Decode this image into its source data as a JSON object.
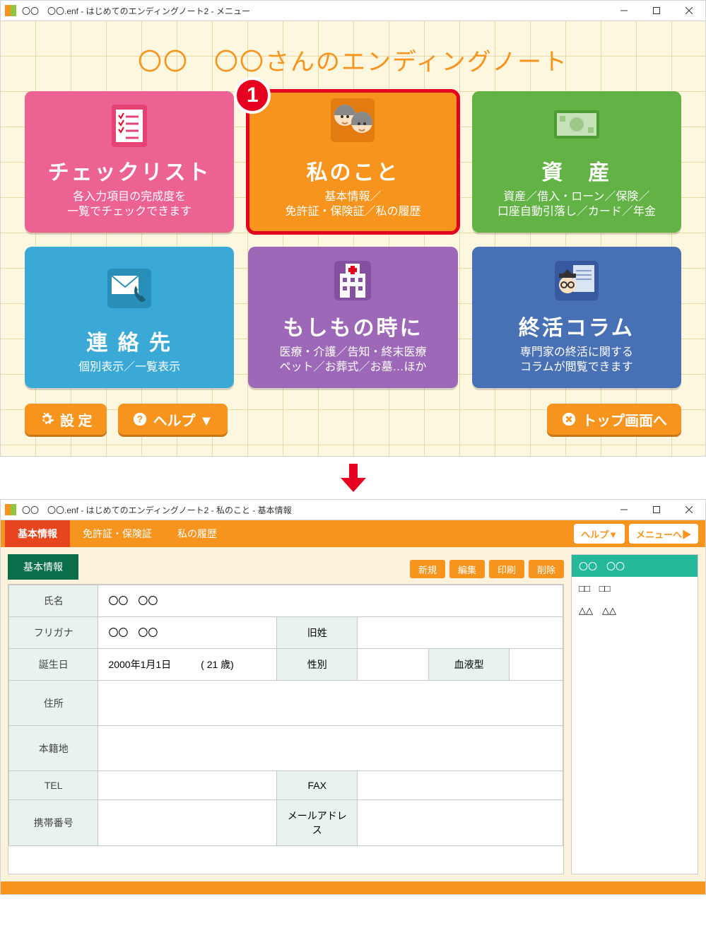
{
  "top_window": {
    "title": "〇〇　〇〇.enf - はじめてのエンディングノート2 - メニュー",
    "page_title": "〇〇　〇〇さんのエンディングノート",
    "cards": [
      {
        "title": "チェックリスト",
        "desc": "各入力項目の完成度を\n一覧でチェックできます"
      },
      {
        "title": "私のこと",
        "desc": "基本情報／\n免許証・保険証／私の履歴"
      },
      {
        "title": "資　産",
        "desc": "資産／借入・ローン／保険／\n口座自動引落し／カード／年金"
      },
      {
        "title": "連 絡 先",
        "desc": "個別表示／一覧表示"
      },
      {
        "title": "もしもの時に",
        "desc": "医療・介護／告知・終末医療\nペット／お葬式／お墓…ほか"
      },
      {
        "title": "終活コラム",
        "desc": "専門家の終活に関する\nコラムが閲覧できます"
      }
    ],
    "badge": "1",
    "settings_btn": "設 定",
    "help_btn": "ヘルプ ▼",
    "top_btn": "トップ画面へ"
  },
  "detail_window": {
    "title": "〇〇　〇〇.enf - はじめてのエンディングノート2 - 私のこと - 基本情報",
    "tabs": [
      "基本情報",
      "免許証・保険証",
      "私の履歴"
    ],
    "help_btn": "ヘルプ▼",
    "menu_btn": "メニューへ▶",
    "section_tab": "基本情報",
    "actions": [
      "新規",
      "編集",
      "印刷",
      "削除"
    ],
    "side_entries": [
      "〇〇　〇〇",
      "□□　□□",
      "△△　△△"
    ],
    "form": {
      "name_label": "氏名",
      "name_value": "〇〇　〇〇",
      "kana_label": "フリガナ",
      "kana_value": "〇〇　〇〇",
      "maiden_label": "旧姓",
      "maiden_value": "",
      "birth_label": "誕生日",
      "birth_value": "2000年1月1日　　　( 21 歳)",
      "sex_label": "性別",
      "sex_value": "",
      "blood_label": "血液型",
      "blood_value": "",
      "addr_label": "住所",
      "addr_value": "",
      "honseki_label": "本籍地",
      "honseki_value": "",
      "tel_label": "TEL",
      "tel_value": "",
      "fax_label": "FAX",
      "fax_value": "",
      "mobile_label": "携帯番号",
      "mobile_value": "",
      "mail_label": "メールアドレス",
      "mail_value": ""
    }
  }
}
